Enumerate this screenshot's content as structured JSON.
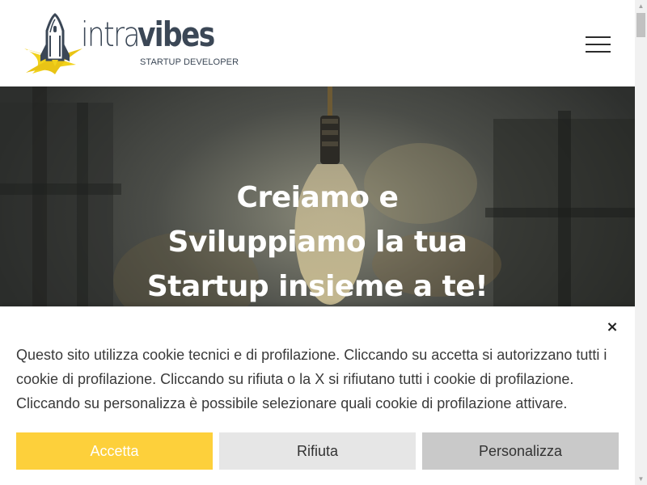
{
  "header": {
    "brand_light": "intra",
    "brand_bold": "vibes",
    "tagline": "STARTUP DEVELOPER",
    "menu_icon": "hamburger-icon"
  },
  "hero": {
    "title_lines": [
      "Creiamo e",
      "Sviluppiamo la tua",
      "Startup insieme a te!"
    ]
  },
  "cookie_banner": {
    "close_label": "×",
    "text": "Questo sito utilizza cookie tecnici e di profilazione. Cliccando su accetta si autorizzano tutti i cookie di profilazione. Cliccando su rifiuta o la X si rifiutano tutti i cookie di profilazione. Cliccando su personalizza è possibile selezionare quali cookie di profilazione attivare.",
    "buttons": {
      "accept": "Accetta",
      "reject": "Rifiuta",
      "customize": "Personalizza"
    }
  },
  "colors": {
    "brand_text": "#3b4756",
    "accent_yellow": "#fdd03b",
    "reject_bg": "#e6e6e6",
    "customize_bg": "#c9c9c9"
  },
  "scrollbar": {
    "up_icon": "scroll-up-arrow-icon",
    "down_icon": "scroll-down-arrow-icon"
  }
}
